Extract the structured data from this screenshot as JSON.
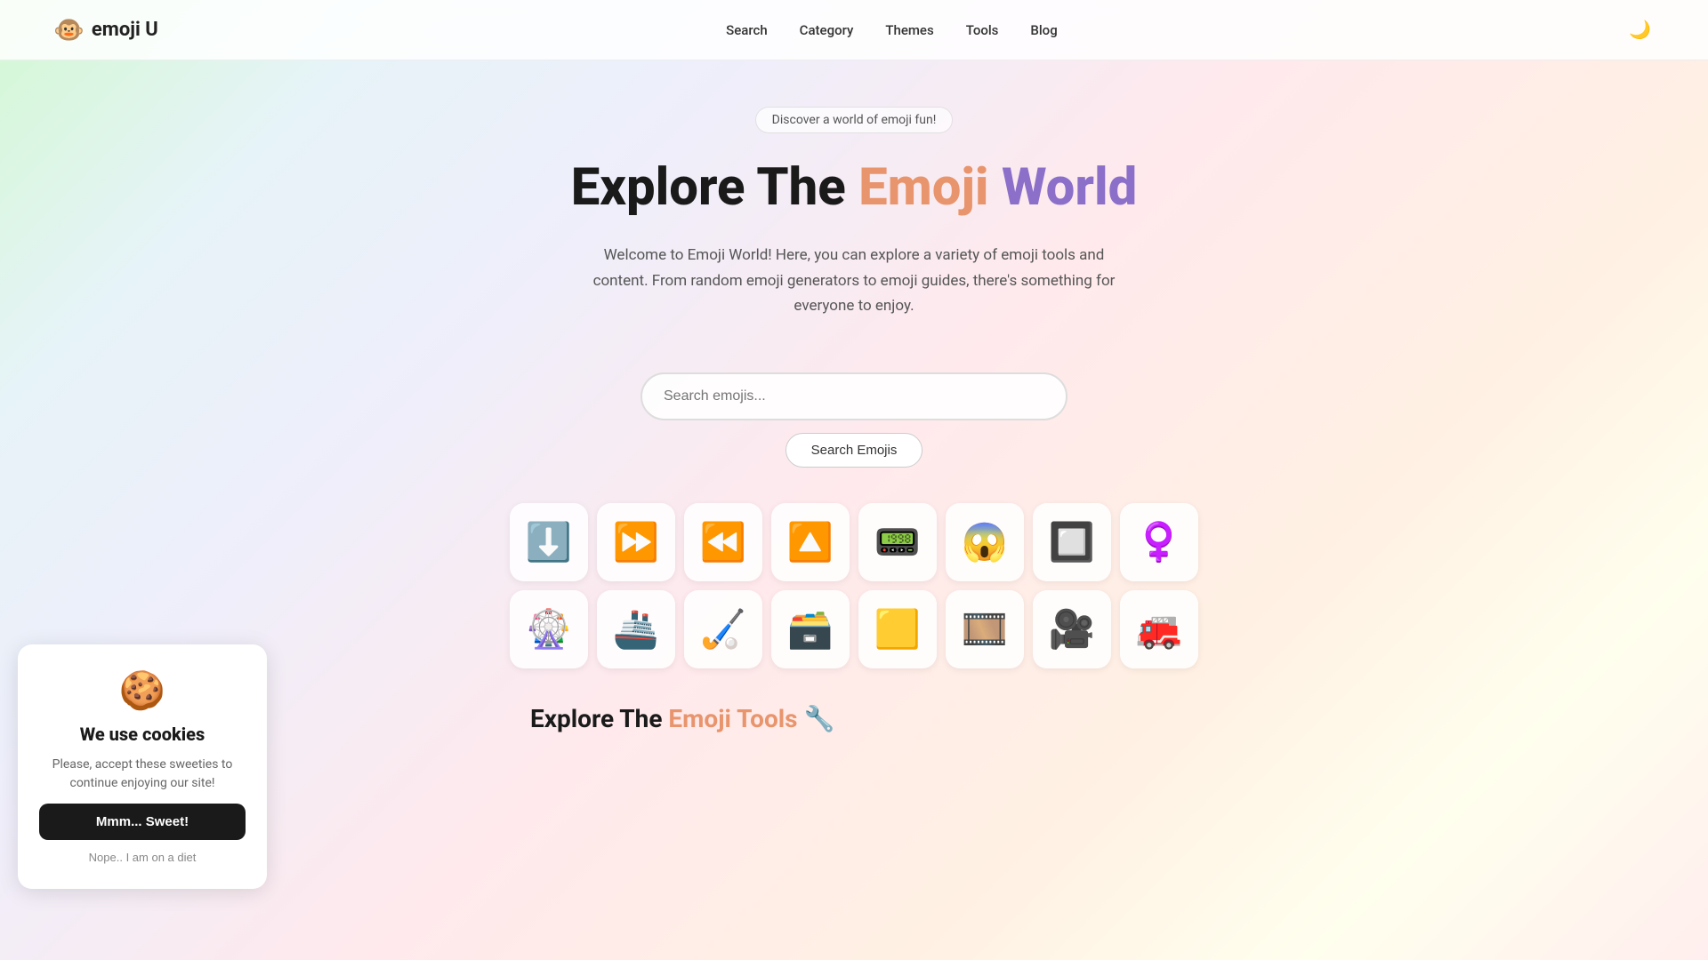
{
  "nav": {
    "logo_emoji": "🐵",
    "logo_text": "emoji U",
    "links": [
      {
        "label": "Search",
        "href": "#"
      },
      {
        "label": "Category",
        "href": "#"
      },
      {
        "label": "Themes",
        "href": "#"
      },
      {
        "label": "Tools",
        "href": "#"
      },
      {
        "label": "Blog",
        "href": "#"
      }
    ],
    "theme_icon": "🌙"
  },
  "hero": {
    "badge": "Discover a world of emoji fun!",
    "title_start": "Explore The ",
    "title_emoji": "Emoji",
    "title_world": " World",
    "subtitle": "Welcome to Emoji World! Here, you can explore a variety of emoji tools and content. From random emoji generators to emoji guides, there's something for everyone to enjoy.",
    "search_placeholder": "Search emojis...",
    "search_btn_label": "Search Emojis"
  },
  "emoji_rows": [
    [
      "⬇️",
      "⏩",
      "⏪",
      "🔼",
      "📟",
      "😱",
      "🔲",
      "♀️"
    ],
    [
      "🎡",
      "🚢",
      "🏑",
      "🗃️",
      "🟨",
      "🎞️",
      "🎥",
      "🚒"
    ]
  ],
  "explore_section": {
    "title_start": "Explore The ",
    "title_tools": "Emoji Tools",
    "title_icon": "🔧"
  },
  "cookie": {
    "icon": "🍪",
    "title": "We use cookies",
    "text": "Please, accept these sweeties to continue enjoying our site!",
    "accept_label": "Mmm... Sweet!",
    "decline_label": "Nope.. I am on a diet"
  }
}
